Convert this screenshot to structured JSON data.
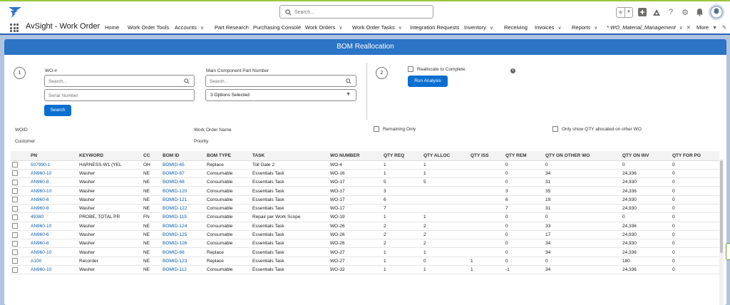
{
  "global_header": {
    "search_placeholder": "Search...",
    "icons": [
      "favorite-star-icon",
      "favorites-menu-icon",
      "add-icon",
      "trailhead-icon",
      "help-icon",
      "setup-gear-icon",
      "notification-bell-icon",
      "user-avatar-icon"
    ]
  },
  "nav": {
    "app_name": "AvSight - Work Order",
    "items": [
      {
        "label": "Home",
        "has_menu": false
      },
      {
        "label": "Work Order Tools",
        "has_menu": false
      },
      {
        "label": "Accounts",
        "has_menu": true
      },
      {
        "label": "Part Research",
        "has_menu": false
      },
      {
        "label": "Purchasing Console",
        "has_menu": false
      },
      {
        "label": "Work Orders",
        "has_menu": true
      },
      {
        "label": "Work Order Tasks",
        "has_menu": true
      },
      {
        "label": "Integration Requests",
        "has_menu": false
      },
      {
        "label": "Inventory",
        "has_menu": true
      },
      {
        "label": "Receiving",
        "has_menu": false
      },
      {
        "label": "Invoices",
        "has_menu": true
      },
      {
        "label": "Reports",
        "has_menu": true
      },
      {
        "label": "* WO_Material_Management",
        "has_menu": true
      }
    ],
    "more_label": "More"
  },
  "card": {
    "title": "BOM Reallocation",
    "step1": {
      "number": "1",
      "wo_label": "WO-#",
      "wo_placeholder": "Search...",
      "serial_placeholder": "Serial Number",
      "search_button": "Search",
      "part_label": "Main Component Part Number",
      "part_placeholder": "Search...",
      "options_value": "3 Options Selected"
    },
    "step2": {
      "number": "2",
      "reallocate_label": "Reallocate to Complete",
      "run_button": "Run Analysis"
    },
    "info": {
      "woid_label": "WOID",
      "customer_label": "Customer",
      "wo_name_label": "Work Order Name",
      "priority_label": "Priority",
      "remaining_only_label": "Remaining Only",
      "only_show_label": "Only show QTY allocated on other WO"
    }
  },
  "table": {
    "columns": [
      "PN",
      "KEYWORD",
      "CC",
      "BOM ID",
      "BOM TYPE",
      "TASK",
      "WO NUMBER",
      "QTY REQ",
      "QTY ALLOC",
      "QTY ISS",
      "QTY REM",
      "QTY ON OTHER WO",
      "QTY ON INV",
      "QTY FOR PO"
    ],
    "rows": [
      [
        "507990-1",
        "HARNESS-W1 (YEL",
        "OH",
        "BOMID-65",
        "Replace",
        "Toll Gate 2",
        "WO-4",
        "1",
        "1",
        "",
        "0",
        "0",
        "0",
        "0"
      ],
      [
        "AN960-10",
        "Washer",
        "NE",
        "BOMID-67",
        "Consumable",
        "Essentials Task",
        "WO-16",
        "1",
        "1",
        "",
        "0",
        "34",
        "24,336",
        "0"
      ],
      [
        "AN960-8",
        "Washer",
        "NE",
        "BOMID-68",
        "Consumable",
        "Essentials Task",
        "WO-17",
        "5",
        "5",
        "",
        "0",
        "31",
        "24,930",
        "0"
      ],
      [
        "AN960-10",
        "Washer",
        "NE",
        "BOMID-120",
        "Consumable",
        "Essentials Task",
        "WO-17",
        "3",
        "",
        "",
        "3",
        "35",
        "24,336",
        "0"
      ],
      [
        "AN960-6",
        "Washer",
        "NE",
        "BOMID-121",
        "Consumable",
        "Essentials Task",
        "WO-17",
        "6",
        "",
        "",
        "6",
        "19",
        "24,930",
        "0"
      ],
      [
        "AN960-8",
        "Washer",
        "NE",
        "BOMID-122",
        "Consumable",
        "Essentials Task",
        "WO-17",
        "7",
        "",
        "",
        "7",
        "31",
        "24,930",
        "0"
      ],
      [
        "49380",
        "PROBE, TOTAL PR",
        "FN",
        "BOMID-119",
        "Consumable",
        "Repair per Work Scope",
        "WO-19",
        "1",
        "1",
        "",
        "0",
        "0",
        "0",
        "0"
      ],
      [
        "AN960-10",
        "Washer",
        "NE",
        "BOMID-124",
        "Consumable",
        "Essentials Task",
        "WO-26",
        "2",
        "2",
        "",
        "0",
        "33",
        "24,336",
        "0"
      ],
      [
        "AN960-6",
        "Washer",
        "NE",
        "BOMID-125",
        "Consumable",
        "Essentials Task",
        "WO-26",
        "2",
        "2",
        "",
        "0",
        "17",
        "24,930",
        "0"
      ],
      [
        "AN960-8",
        "Washer",
        "NE",
        "BOMID-126",
        "Consumable",
        "Essentials Task",
        "WO-26",
        "2",
        "2",
        "",
        "0",
        "34",
        "24,930",
        "0"
      ],
      [
        "AN960-10",
        "Washer",
        "NE",
        "BOMID-66",
        "Replace",
        "Essentials Task",
        "WO-27",
        "1",
        "1",
        "",
        "0",
        "34",
        "24,336",
        "0"
      ],
      [
        "A100",
        "Recorder",
        "NE",
        "BOMID-123",
        "Replace",
        "Essentials Task",
        "WO-27",
        "1",
        "0",
        "1",
        "0",
        "0",
        "180",
        "0"
      ],
      [
        "AN960-10",
        "Washer",
        "NE",
        "BOMID-112",
        "Consumable",
        "Essentials Task",
        "WO-32",
        "1",
        "1",
        "1",
        "-1",
        "34",
        "24,336",
        "0"
      ]
    ]
  },
  "colors": {
    "brand_blue": "#2b74c6",
    "button_blue": "#0b6fd0",
    "link_blue": "#0b5cab",
    "background": "#b0c4df",
    "accent_green": "#9cc53d"
  }
}
